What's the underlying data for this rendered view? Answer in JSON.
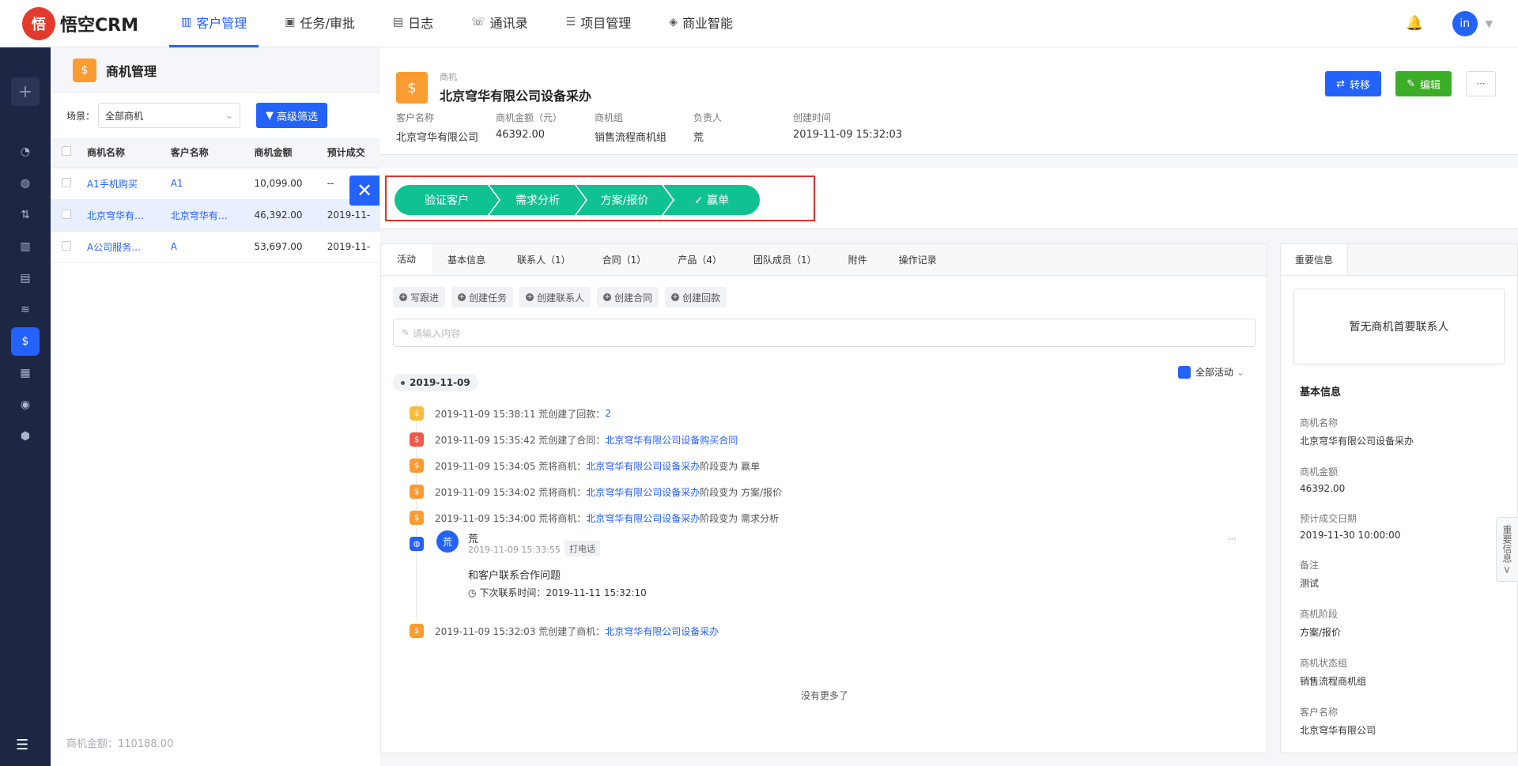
{
  "app": {
    "logo_text": "悟空CRM",
    "logo_mark": "悟"
  },
  "nav": {
    "items": [
      {
        "label": "客户管理",
        "icon": "building-icon",
        "glyph": "▥",
        "active": true
      },
      {
        "label": "任务/审批",
        "icon": "briefcase-icon",
        "glyph": "▣"
      },
      {
        "label": "日志",
        "icon": "notebook-icon",
        "glyph": "▤"
      },
      {
        "label": "通讯录",
        "icon": "phonebook-icon",
        "glyph": "☏"
      },
      {
        "label": "项目管理",
        "icon": "list-icon",
        "glyph": "☰"
      },
      {
        "label": "商业智能",
        "icon": "shield-icon",
        "glyph": "◈"
      }
    ],
    "user_initials": "in"
  },
  "list": {
    "title": "商机管理",
    "scene_label": "场景：",
    "scene_value": "全部商机",
    "advanced_filter": "高级筛选",
    "columns": [
      "商机名称",
      "客户名称",
      "商机金额",
      "预计成交"
    ],
    "rows": [
      {
        "name": "A1手机购买",
        "customer": "A1",
        "amount": "10,099.00",
        "date": "--"
      },
      {
        "name": "北京穹华有…",
        "customer": "北京穹华有…",
        "amount": "46,392.00",
        "date": "2019-11-"
      },
      {
        "name": "A公司服务…",
        "customer": "A",
        "amount": "53,697.00",
        "date": "2019-11-"
      }
    ],
    "footer": "商机金额：110188.00"
  },
  "detail": {
    "type_label": "商机",
    "name": "北京穹华有限公司设备采办",
    "transfer_button": "转移",
    "edit_button": "编辑",
    "more_button": "···",
    "fields": [
      {
        "key": "客户名称",
        "value": "北京穹华有限公司"
      },
      {
        "key": "商机金额（元）",
        "value": "46392.00"
      },
      {
        "key": "商机组",
        "value": "销售流程商机组"
      },
      {
        "key": "负责人",
        "value": "荒"
      },
      {
        "key": "创建时间",
        "value": "2019-11-09 15:32:03"
      }
    ],
    "stages": [
      "验证客户",
      "需求分析",
      "方案/报价",
      "✓  赢单"
    ],
    "stage_color": "#10c192"
  },
  "activity": {
    "tabs": [
      "活动",
      "基本信息",
      "联系人（1）",
      "合同（1）",
      "产品（4）",
      "团队成员（1）",
      "附件",
      "操作记录"
    ],
    "quick_buttons": [
      "写跟进",
      "创建任务",
      "创建联系人",
      "创建合同",
      "创建回款"
    ],
    "input_placeholder": "请输入内容",
    "date_chip": "2019-11-09",
    "filter_label": "全部活动",
    "events": [
      {
        "text": "2019-11-09 15:38:11 荒创建了回款：",
        "link": "2",
        "color": "#fbbc3c"
      },
      {
        "text": "2019-11-09 15:35:42 荒创建了合同：",
        "link": "北京穹华有限公司设备购买合同",
        "color": "#f05a4a"
      },
      {
        "text": "2019-11-09 15:34:05 荒将商机：",
        "link": "北京穹华有限公司设备采办",
        "suffix": " 阶段变为 赢单",
        "color": "#fb9c32"
      },
      {
        "text": "2019-11-09 15:34:02 荒将商机：",
        "link": "北京穹华有限公司设备采办",
        "suffix": " 阶段变为 方案/报价",
        "color": "#fb9c32"
      },
      {
        "text": "2019-11-09 15:34:00 荒将商机：",
        "link": "北京穹华有限公司设备采办",
        "suffix": " 阶段变为 需求分析",
        "color": "#fb9c32"
      }
    ],
    "note": {
      "author": "荒",
      "avatar_text": "荒",
      "time": "2019-11-09 15:33:55",
      "tag": "打电话",
      "content": "和客户联系合作问题",
      "next_contact": "下次联系时间：2019-11-11 15:32:10",
      "more": "···"
    },
    "last_event": {
      "text": "2019-11-09 15:32:03 荒创建了商机：",
      "link": "北京穹华有限公司设备采办",
      "color": "#fb9c32"
    },
    "no_more": "没有更多了"
  },
  "info": {
    "tab": "重要信息",
    "empty_contact": "暂无商机首要联系人",
    "section": "基本信息",
    "rows": [
      {
        "key": "商机名称",
        "value": "北京穹华有限公司设备采办"
      },
      {
        "key": "商机金额",
        "value": "46392.00"
      },
      {
        "key": "预计成交日期",
        "value": "2019-11-30 10:00:00"
      },
      {
        "key": "备注",
        "value": "测试"
      },
      {
        "key": "商机阶段",
        "value": "方案/报价"
      },
      {
        "key": "商机状态组",
        "value": "销售流程商机组"
      },
      {
        "key": "客户名称",
        "value": "北京穹华有限公司"
      }
    ],
    "side_handle": "重要信息 >"
  }
}
